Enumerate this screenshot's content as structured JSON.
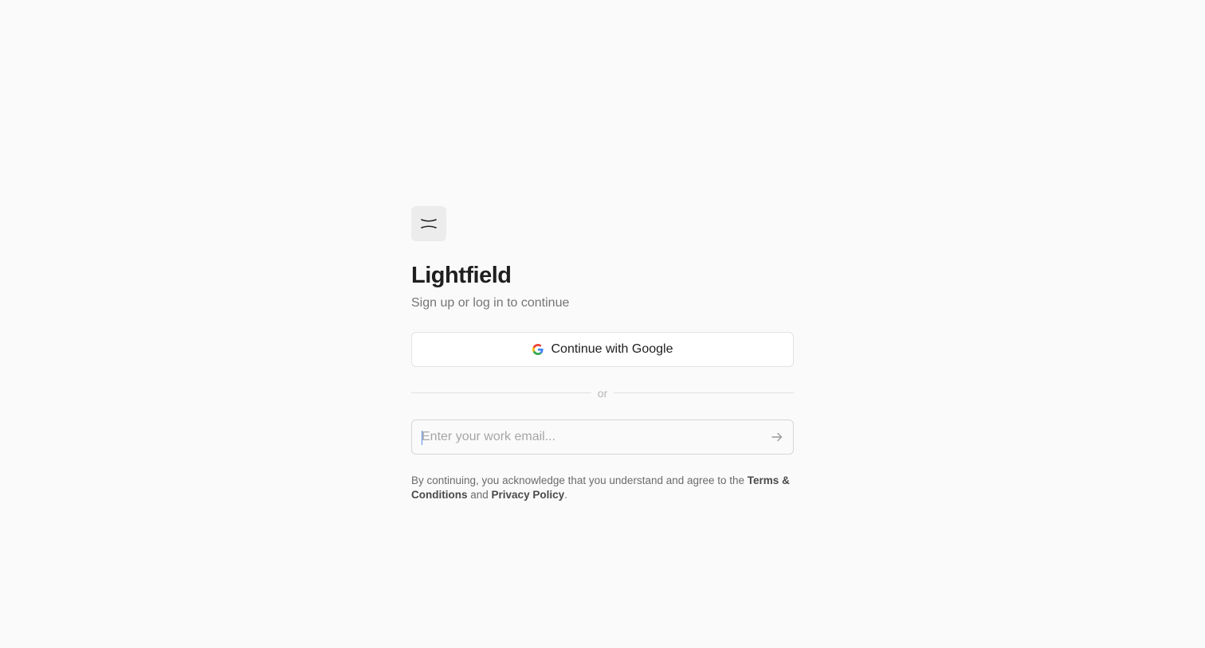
{
  "brand": {
    "name": "Lightfield",
    "logo_icon": "lightfield-logo-icon"
  },
  "auth": {
    "subtitle": "Sign up or log in to continue",
    "google_button_label": "Continue with Google",
    "google_icon": "google-g-icon",
    "divider_label": "or",
    "email_placeholder": "Enter your work email...",
    "email_value": "",
    "submit_icon": "arrow-right-icon"
  },
  "legal": {
    "prefix": "By continuing, you acknowledge that you understand and agree to the ",
    "terms_link": "Terms & Conditions",
    "middle": " and ",
    "privacy_link": "Privacy Policy",
    "suffix": "."
  },
  "colors": {
    "background": "#fafafa",
    "text_primary": "#1f1f1f",
    "text_secondary": "#757575",
    "border": "#e3e3e3",
    "caret": "#5b8def"
  }
}
